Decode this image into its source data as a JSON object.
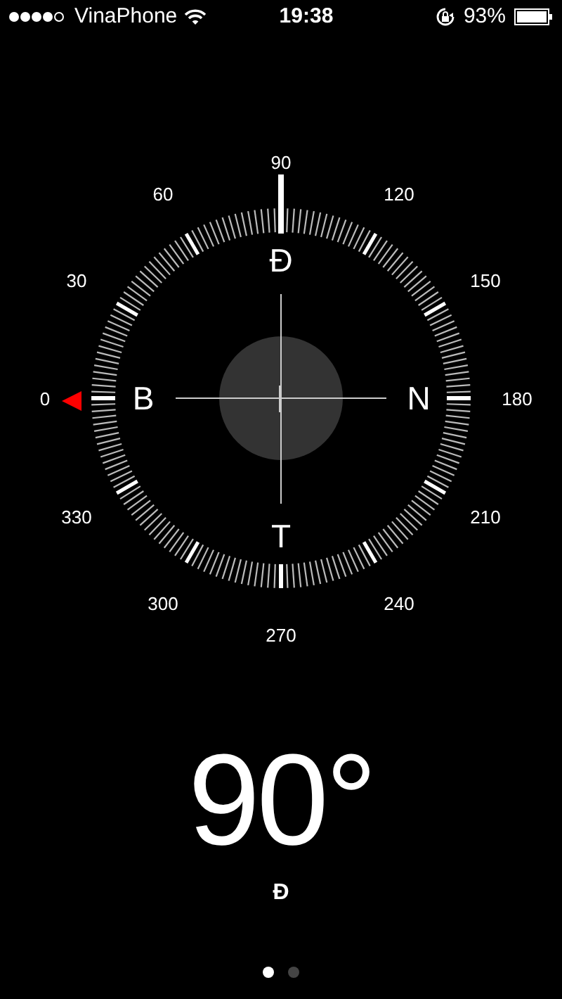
{
  "status_bar": {
    "carrier": "VinaPhone",
    "time": "19:38",
    "battery": "93%"
  },
  "compass": {
    "degree_labels": [
      "0",
      "30",
      "60",
      "90",
      "120",
      "150",
      "180",
      "210",
      "240",
      "270",
      "300",
      "330"
    ],
    "cardinal_letters": [
      "B",
      "Đ",
      "N",
      "T"
    ]
  },
  "heading": {
    "degrees": "90°",
    "direction": "Đ"
  },
  "pages": [
    {
      "selected": true
    },
    {
      "selected": false
    }
  ]
}
